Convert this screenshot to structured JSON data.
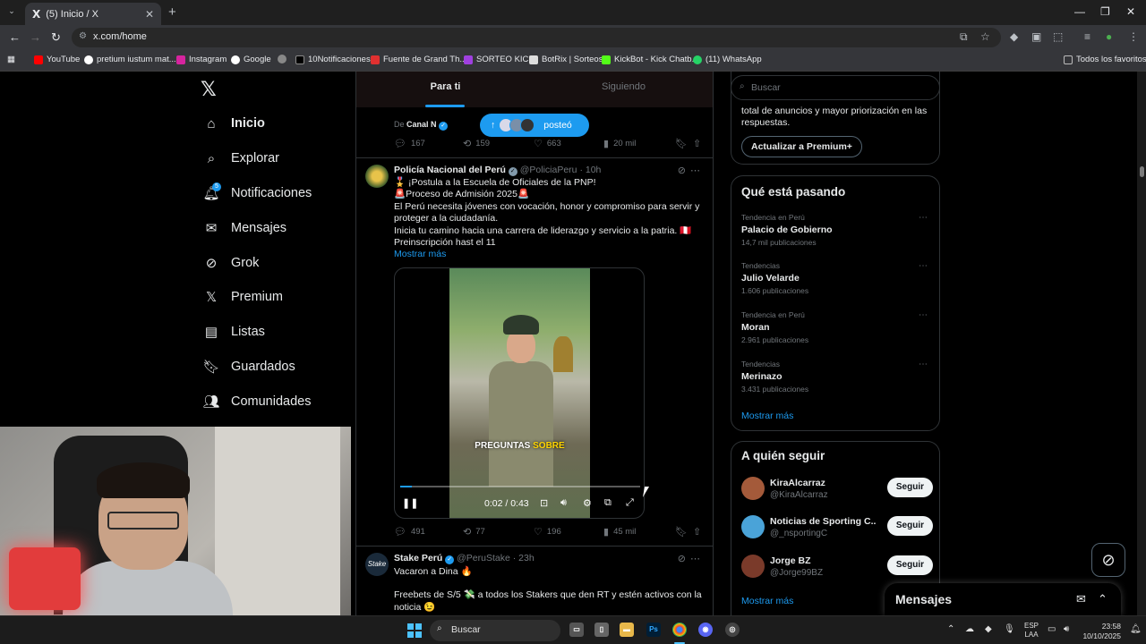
{
  "browser": {
    "tab_title": "(5) Inicio / X",
    "url": "x.com/home",
    "bookmarks": [
      "YouTube",
      "pretium iustum mat...",
      "Instagram",
      "Google",
      "10Notificaciones",
      "Fuente de Grand Th...",
      "SORTEO KICK",
      "BotRix | Sorteos",
      "KickBot - Kick Chatb...",
      "(11) WhatsApp"
    ],
    "all_bookmarks": "Todos los favoritos",
    "colors": {
      "x_blue": "#1d9bf0",
      "background": "#000000"
    }
  },
  "nav": {
    "items": [
      {
        "label": "Inicio",
        "icon": "home-icon"
      },
      {
        "label": "Explorar",
        "icon": "search-icon"
      },
      {
        "label": "Notificaciones",
        "icon": "bell-icon"
      },
      {
        "label": "Mensajes",
        "icon": "mail-icon"
      },
      {
        "label": "Grok",
        "icon": "grok-icon"
      },
      {
        "label": "Premium",
        "icon": "x-icon"
      },
      {
        "label": "Listas",
        "icon": "list-icon"
      },
      {
        "label": "Guardados",
        "icon": "bookmark-icon"
      },
      {
        "label": "Comunidades",
        "icon": "people-icon"
      }
    ],
    "notif_count": "5"
  },
  "timeline": {
    "tabs": [
      "Para ti",
      "Siguiendo"
    ],
    "source_prefix": "De",
    "source_name": "Canal N",
    "posted_pill": "posteó",
    "prev_actions": {
      "replies": "167",
      "reposts": "159",
      "likes": "663",
      "views": "20 mil"
    },
    "post1": {
      "name": "Policía Nacional del Perú",
      "handle": "@PoliciaPeru",
      "time": "10h",
      "lines": [
        "🎖️ ¡Postula a la Escuela de Oficiales de la PNP!",
        "🚨Proceso de Admisión 2025🚨",
        "El Perú necesita jóvenes con vocación, honor y compromiso para servir y proteger a la ciudadanía.",
        "Inicia tu camino hacia una carrera de liderazgo y servicio a la patria. 🇵🇪",
        "Preinscripción hast el 11"
      ],
      "show_more": "Mostrar más",
      "video": {
        "caption_white": "PREGUNTAS",
        "caption_yellow": "SOBRE",
        "time": "0:02 / 0:43",
        "progress": 0.047
      },
      "actions": {
        "replies": "491",
        "reposts": "77",
        "likes": "196",
        "views": "45 mil"
      }
    },
    "post2": {
      "name": "Stake Perú",
      "handle": "@PeruStake",
      "time": "23h",
      "text1": "Vacaron a Dina 🔥",
      "text2": "Freebets de S/5 💸 a todos los Stakers que den RT y estén activos con la noticia 😉"
    }
  },
  "sidebar": {
    "search_placeholder": "Buscar",
    "premium_text": "total de anuncios y mayor priorización en las respuestas.",
    "premium_button": "Actualizar a Premium+",
    "trending_title": "Qué está pasando",
    "trends": [
      {
        "context": "Tendencia en Perú",
        "name": "Palacio de Gobierno",
        "posts": "14,7 mil publicaciones"
      },
      {
        "context": "Tendencias",
        "name": "Julio Velarde",
        "posts": "1.606 publicaciones"
      },
      {
        "context": "Tendencia en Perú",
        "name": "Moran",
        "posts": "2.961 publicaciones"
      },
      {
        "context": "Tendencias",
        "name": "Merinazo",
        "posts": "3.431 publicaciones"
      }
    ],
    "show_more": "Mostrar más",
    "follow_title": "A quién seguir",
    "follow": [
      {
        "name": "KiraAlcarraz",
        "handle": "@KiraAlcarraz",
        "button": "Seguir"
      },
      {
        "name": "Noticias de Sporting C...",
        "handle": "@_nsportingC",
        "button": "Seguir"
      },
      {
        "name": "Jorge BZ",
        "handle": "@Jorge99BZ",
        "button": "Seguir"
      }
    ],
    "follow_more": "Mostrar más"
  },
  "messages_drawer": {
    "title": "Mensajes"
  },
  "taskbar": {
    "search": "Buscar",
    "lang_top": "ESP",
    "lang_bottom": "LAA",
    "time": "23:58",
    "date": "10/10/2025"
  }
}
